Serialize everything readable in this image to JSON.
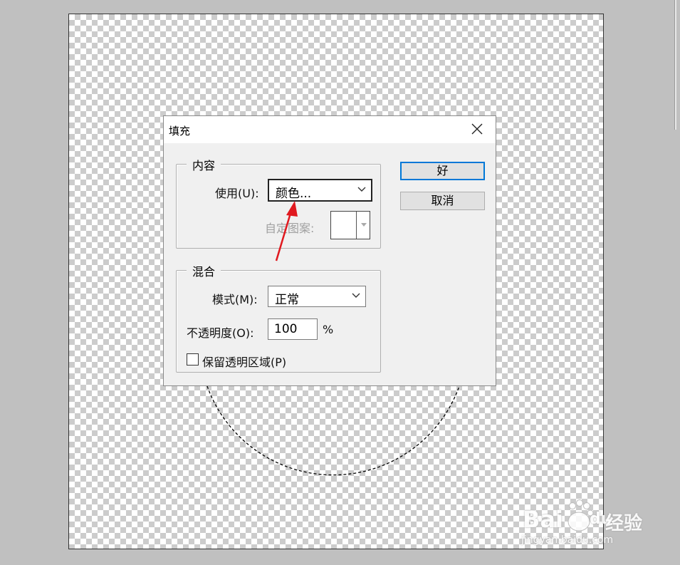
{
  "dialog": {
    "title": "填充",
    "close_icon": "close-icon",
    "content_group": {
      "legend": "内容",
      "use_label": "使用(U):",
      "use_value": "颜色...",
      "custom_pattern_label": "自定图案:"
    },
    "blend_group": {
      "legend": "混合",
      "mode_label": "模式(M):",
      "mode_value": "正常",
      "opacity_label": "不透明度(O):",
      "opacity_value": "100",
      "opacity_unit": "%",
      "preserve_transparency_label": "保留透明区域(P)",
      "preserve_transparency_checked": false
    },
    "buttons": {
      "ok_label": "好",
      "cancel_label": "取消"
    }
  },
  "annotation": {
    "arrow_color": "#e0191f"
  },
  "watermark": {
    "brand_part1": "Bai",
    "brand_part2": "du",
    "brand_cn": "经验",
    "url": "jingyan.baidu.com"
  }
}
